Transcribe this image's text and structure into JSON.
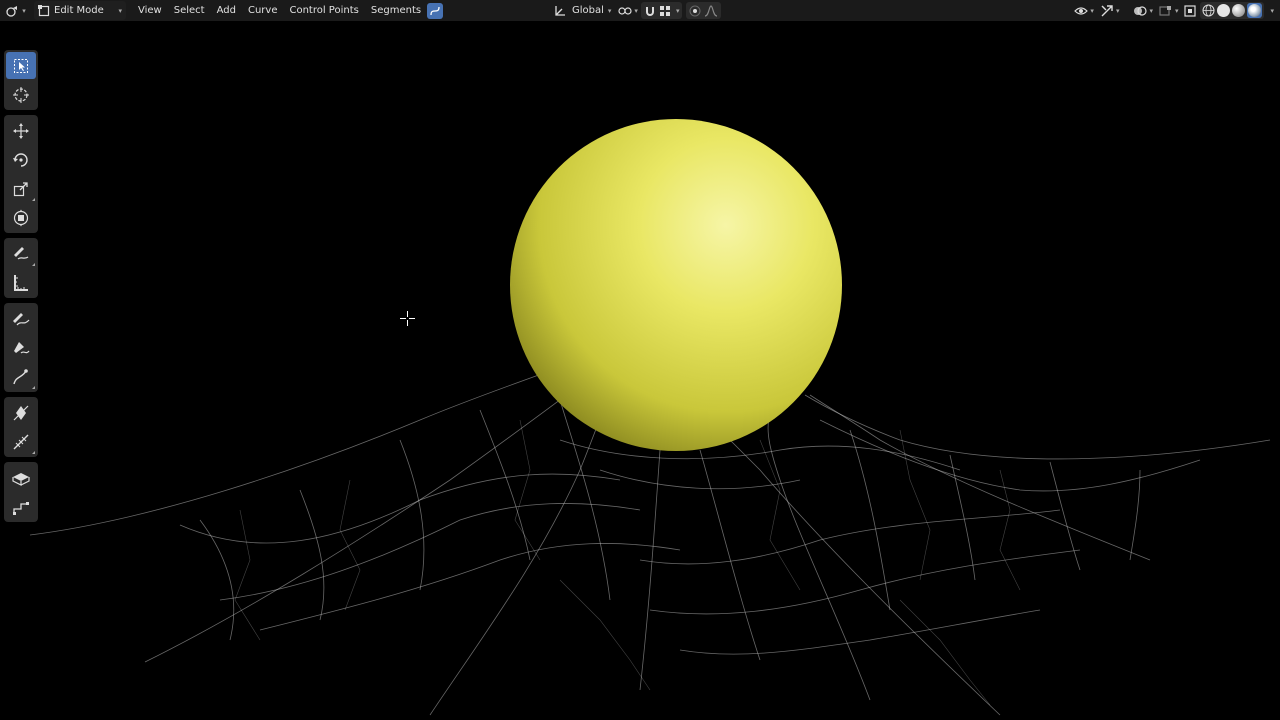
{
  "header": {
    "mode": "Edit Mode",
    "menus": [
      "View",
      "Select",
      "Add",
      "Curve",
      "Control Points",
      "Segments"
    ],
    "transform_orientation": "Global"
  },
  "colors": {
    "accent": "#4772b3",
    "header_bg": "#1a1a1a",
    "viewport_bg": "#000000",
    "sphere": "#e8e65a"
  },
  "toolbar": {
    "tools": [
      "select-box",
      "cursor",
      "move",
      "rotate",
      "scale",
      "transform",
      "annotate",
      "measure",
      "draw",
      "pen",
      "curve-tilt",
      "radius",
      "randomize",
      "extrude",
      "extrude-cursor"
    ]
  }
}
